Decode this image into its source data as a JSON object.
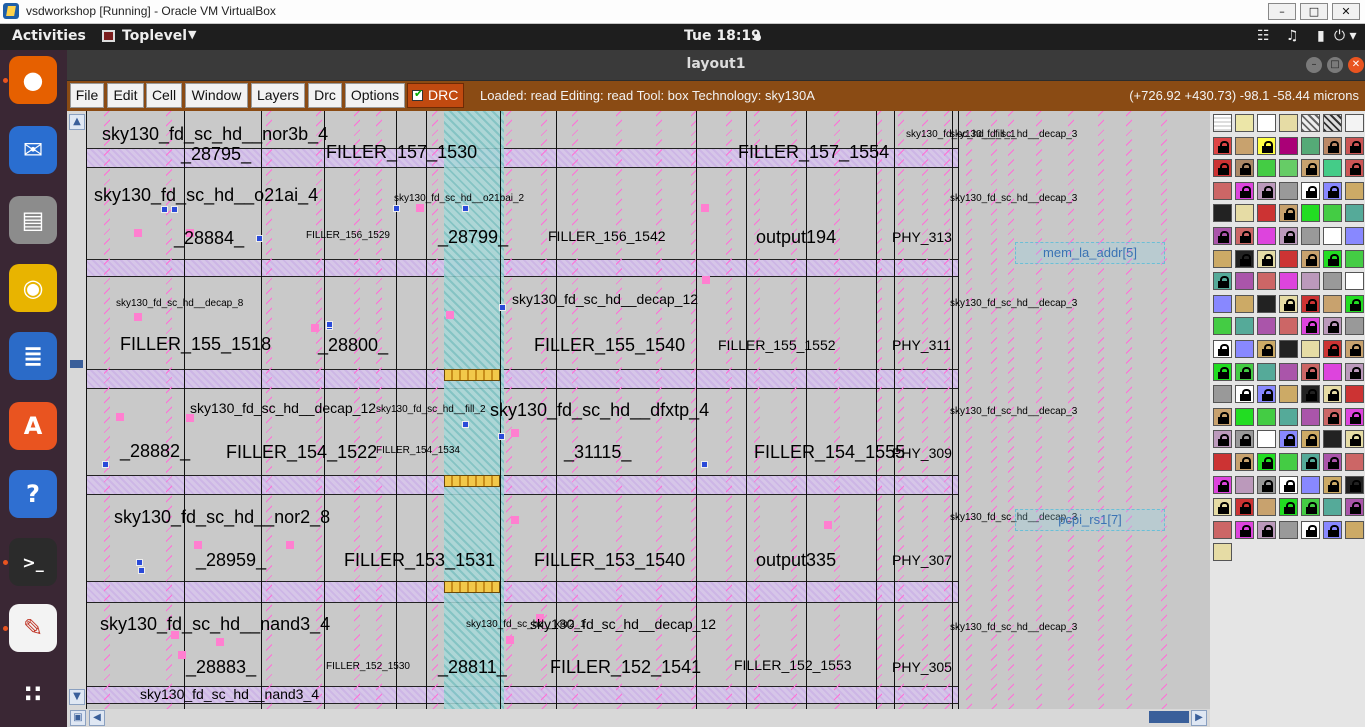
{
  "vbox": {
    "title": "vsdworkshop [Running] - Oracle VM VirtualBox",
    "btn_minimize": "–",
    "btn_maximize": "□",
    "btn_close": "✕"
  },
  "topbar": {
    "activities": "Activities",
    "app_name": "Toplevel",
    "app_caret": "▼",
    "clock": "Tue 18:19",
    "tray_icons": [
      "network-icon",
      "volume-icon",
      "battery-icon",
      "power-menu-icon"
    ],
    "tray_glyphs": [
      "☷",
      "♫",
      "▮",
      "⏻ ▾"
    ]
  },
  "dock": {
    "items": [
      {
        "name": "firefox",
        "glyph": "●",
        "color": "#e66000",
        "running": true
      },
      {
        "name": "thunderbird",
        "glyph": "✉",
        "color": "#2a6ed0",
        "running": false
      },
      {
        "name": "files",
        "glyph": "▤",
        "color": "#8c8c8c",
        "running": false
      },
      {
        "name": "rhythmbox",
        "glyph": "◉",
        "color": "#e8b400",
        "running": false
      },
      {
        "name": "libreoffice-writer",
        "glyph": "≣",
        "color": "#2b6bc8",
        "running": false
      },
      {
        "name": "software-center",
        "glyph": "A",
        "color": "#e95420",
        "running": false
      },
      {
        "name": "help",
        "glyph": "?",
        "color": "#2f6fd1",
        "running": false
      },
      {
        "name": "terminal",
        "glyph": ">_",
        "color": "#2b2b2b",
        "running": true
      },
      {
        "name": "text-editor",
        "glyph": "✎",
        "color": "#f3f3f3",
        "running": true
      },
      {
        "name": "show-applications",
        "glyph": "∷",
        "color": "#3a2734",
        "running": false
      }
    ]
  },
  "window": {
    "title": "layout1",
    "minimize": "–",
    "maximize": "□",
    "close": "✕"
  },
  "menu": {
    "items": [
      "File",
      "Edit",
      "Cell",
      "Window",
      "Layers",
      "Drc",
      "Options"
    ],
    "drc_checkbox": {
      "label": "DRC",
      "checked": true,
      "check_glyph": "✔"
    },
    "status": "Loaded: read Editing: read Tool: box  Technology: sky130A",
    "coords": "(+726.92 +430.73) -98.1 -58.44 microns"
  },
  "scroll": {
    "up": "▲",
    "down": "▼",
    "left": "◀",
    "right": "▶",
    "zoom_box": "▣"
  },
  "layout": {
    "labels": [
      {
        "text": "sky130_fd_sc_hd__nor3b_4",
        "size": "big"
      },
      {
        "text": "_28795_",
        "size": "big"
      },
      {
        "text": "FILLER_157_1530",
        "size": "big"
      },
      {
        "text": "FILLER_157_1554",
        "size": "big"
      },
      {
        "text": "sky130_fd_sc_hd__o21ai_4",
        "size": "big"
      },
      {
        "text": "_28884_",
        "size": "big"
      },
      {
        "text": "FILLER_156_1529",
        "size": "small"
      },
      {
        "text": "_28799_",
        "size": "big"
      },
      {
        "text": "FILLER_156_1542",
        "size": "mid"
      },
      {
        "text": "output194",
        "size": "big"
      },
      {
        "text": "PHY_313",
        "size": "mid"
      },
      {
        "text": "FILLER_155_1518",
        "size": "big"
      },
      {
        "text": "_28800_",
        "size": "big"
      },
      {
        "text": "sky130_fd_sc_hd__decap_12",
        "size": "mid"
      },
      {
        "text": "FILLER_155_1540",
        "size": "big"
      },
      {
        "text": "FILLER_155_1552",
        "size": "mid"
      },
      {
        "text": "PHY_311",
        "size": "mid"
      },
      {
        "text": "sky130_fd_sc_hd__decap_12",
        "size": "mid"
      },
      {
        "text": "sky130_fd_sc_hd__dfxtp_4",
        "size": "big"
      },
      {
        "text": "_28882_",
        "size": "big"
      },
      {
        "text": "FILLER_154_1522",
        "size": "big"
      },
      {
        "text": "FILLER_154_1534",
        "size": "small"
      },
      {
        "text": "_31115_",
        "size": "big"
      },
      {
        "text": "FILLER_154_1555",
        "size": "big"
      },
      {
        "text": "PHY_309",
        "size": "mid"
      },
      {
        "text": "sky130_fd_sc_hd__nor2_8",
        "size": "big"
      },
      {
        "text": "_28959_",
        "size": "big"
      },
      {
        "text": "FILLER_153_1531",
        "size": "big"
      },
      {
        "text": "FILLER_153_1540",
        "size": "big"
      },
      {
        "text": "output335",
        "size": "big"
      },
      {
        "text": "PHY_307",
        "size": "mid"
      },
      {
        "text": "sky130_fd_sc_hd__nand3_4",
        "size": "big"
      },
      {
        "text": "_28883_",
        "size": "big"
      },
      {
        "text": "FILLER_152_1530",
        "size": "small"
      },
      {
        "text": "_28811_",
        "size": "big"
      },
      {
        "text": "sky130_fd_sc_hd__decap_12",
        "size": "mid"
      },
      {
        "text": "FILLER_152_1541",
        "size": "big"
      },
      {
        "text": "FILLER_152_1553",
        "size": "mid"
      },
      {
        "text": "PHY_305",
        "size": "mid"
      },
      {
        "text": "sky130_fd_sc_hd__nand3_4",
        "size": "mid"
      },
      {
        "text": "sky130_fd_sc_hd__decap_3",
        "size": "small"
      },
      {
        "text": "sky130_fd_sc_hd__decap_3",
        "size": "small"
      },
      {
        "text": "sky130_fd_sc_hd__decap_3",
        "size": "small"
      },
      {
        "text": "sky130_fd_sc_hd__decap_3",
        "size": "small"
      },
      {
        "text": "sky130_fd_sc_hd__decap_3",
        "size": "small"
      },
      {
        "text": "sky130_fd_sc_hd__decap_3",
        "size": "small"
      },
      {
        "text": "sky130_fd_sc_hd__fill_1",
        "size": "small"
      },
      {
        "text": "sky130_fd_sc_hd__o21bai_2",
        "size": "small"
      },
      {
        "text": "sky130_fd_sc_hd__decap_8",
        "size": "small"
      },
      {
        "text": "sky130_fd_sc_hd__fill_2",
        "size": "small"
      },
      {
        "text": "sky130_fd_sc_hd__xor2_1",
        "size": "small"
      }
    ],
    "pins": [
      {
        "text": "mem_la_addr[5]"
      },
      {
        "text": "pcpi_rs1[7]"
      }
    ]
  },
  "palette": {
    "rows": 20,
    "cols": 7
  }
}
